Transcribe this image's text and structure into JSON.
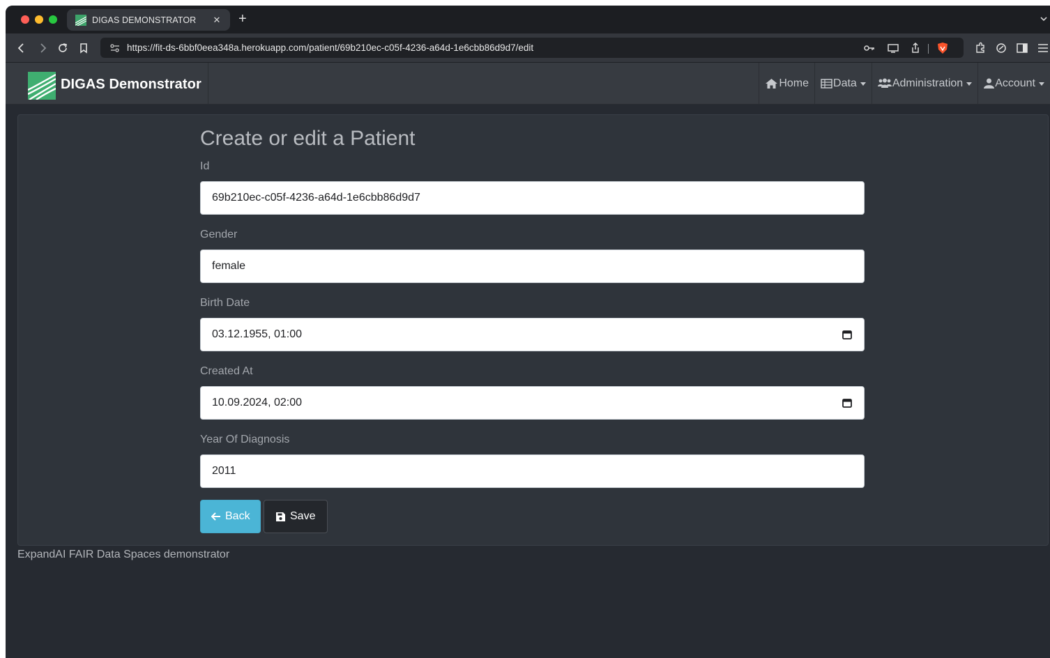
{
  "browser": {
    "tab_title": "DIGAS DEMONSTRATOR",
    "new_tab_symbol": "+",
    "close_symbol": "✕",
    "url": "https://fit-ds-6bbf0eea348a.herokuapp.com/patient/69b210ec-c05f-4236-a64d-1e6cbb86d9d7/edit"
  },
  "navbar": {
    "brand": "DIGAS Demonstrator",
    "items": [
      {
        "label": "Home",
        "icon": "home-icon",
        "dropdown": false
      },
      {
        "label": "Data",
        "icon": "table-icon",
        "dropdown": true
      },
      {
        "label": "Administration",
        "icon": "users-icon",
        "dropdown": true
      },
      {
        "label": "Account",
        "icon": "user-icon",
        "dropdown": true
      }
    ]
  },
  "form": {
    "title": "Create or edit a Patient",
    "fields": {
      "id": {
        "label": "Id",
        "value": "69b210ec-c05f-4236-a64d-1e6cbb86d9d7"
      },
      "gender": {
        "label": "Gender",
        "value": "female"
      },
      "birth_date": {
        "label": "Birth Date",
        "value": "03.12.1955, 01:00"
      },
      "created_at": {
        "label": "Created At",
        "value": "10.09.2024, 02:00"
      },
      "year_of_diagnosis": {
        "label": "Year Of Diagnosis",
        "value": "2011"
      }
    },
    "back_label": "Back",
    "save_label": "Save"
  },
  "footer": {
    "text": "ExpandAI FAIR Data Spaces demonstrator"
  },
  "colors": {
    "page_bg": "#262a31",
    "navbar_bg": "#373b41",
    "card_bg": "#2f343b",
    "back_button": "#4bb5d6",
    "save_button": "#24272c",
    "brave_shield": "#fb542b"
  }
}
